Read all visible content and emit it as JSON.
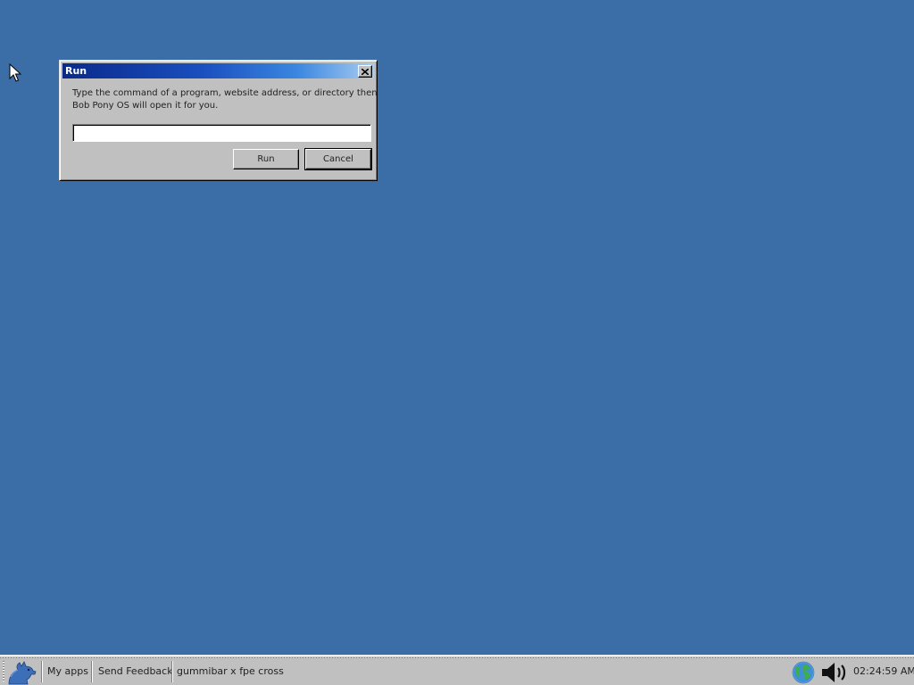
{
  "dialog": {
    "title": "Run",
    "prompt_line1": "Type the command of a program, website address, or directory then",
    "prompt_line2": "Bob Pony OS will open it for you.",
    "input_value": "",
    "run_label": "Run",
    "cancel_label": "Cancel"
  },
  "taskbar": {
    "start_icon": "bob-pony-logo-icon",
    "items": [
      {
        "label": "My apps"
      },
      {
        "label": "Send Feedback"
      },
      {
        "label": "gummibar x fpe cross"
      }
    ],
    "tray": {
      "network_icon": "globe-icon",
      "volume_icon": "speaker-icon",
      "clock": "02:24:59 AM"
    }
  },
  "colors": {
    "desktop": "#3b6ea6",
    "title_start": "#0a2a8a",
    "title_end": "#a8cdf0",
    "window_face": "#c0c0c0"
  }
}
